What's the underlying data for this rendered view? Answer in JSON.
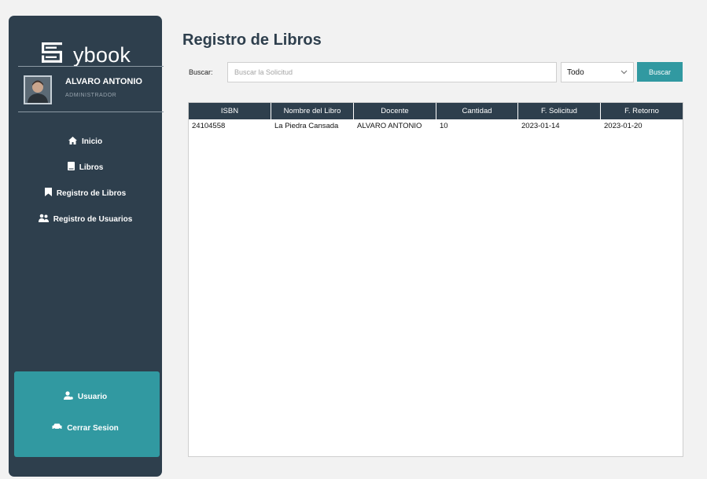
{
  "app": {
    "brand": "ybook"
  },
  "user": {
    "name": "ALVARO ANTONIO",
    "role": "ADMINISTRADOR"
  },
  "sidebar": {
    "items": [
      {
        "label": "Inicio",
        "icon": "home-icon"
      },
      {
        "label": "Libros",
        "icon": "book-icon"
      },
      {
        "label": "Registro de Libros",
        "icon": "bookmark-icon"
      },
      {
        "label": "Registro de Usuarios",
        "icon": "users-icon"
      }
    ],
    "footer": [
      {
        "label": "Usuario",
        "icon": "user-cog-icon"
      },
      {
        "label": "Cerrar Sesion",
        "icon": "car-icon"
      }
    ]
  },
  "main": {
    "title": "Registro de Libros",
    "search": {
      "label": "Buscar:",
      "placeholder": "Buscar la Solicitud",
      "value": "",
      "filter_value": "Todo",
      "button_label": "Buscar"
    },
    "table": {
      "columns": [
        "ISBN",
        "Nombre del Libro",
        "Docente",
        "Cantidad",
        "F. Solicitud",
        "F. Retorno"
      ],
      "rows": [
        [
          "24104558",
          "La Piedra Cansada",
          "ALVARO ANTONIO",
          "10",
          "2023-01-14",
          "2023-01-20"
        ]
      ]
    }
  },
  "colors": {
    "sidebar": "#2e3f4d",
    "accent": "#3199a1",
    "background": "#f2f2f2"
  }
}
